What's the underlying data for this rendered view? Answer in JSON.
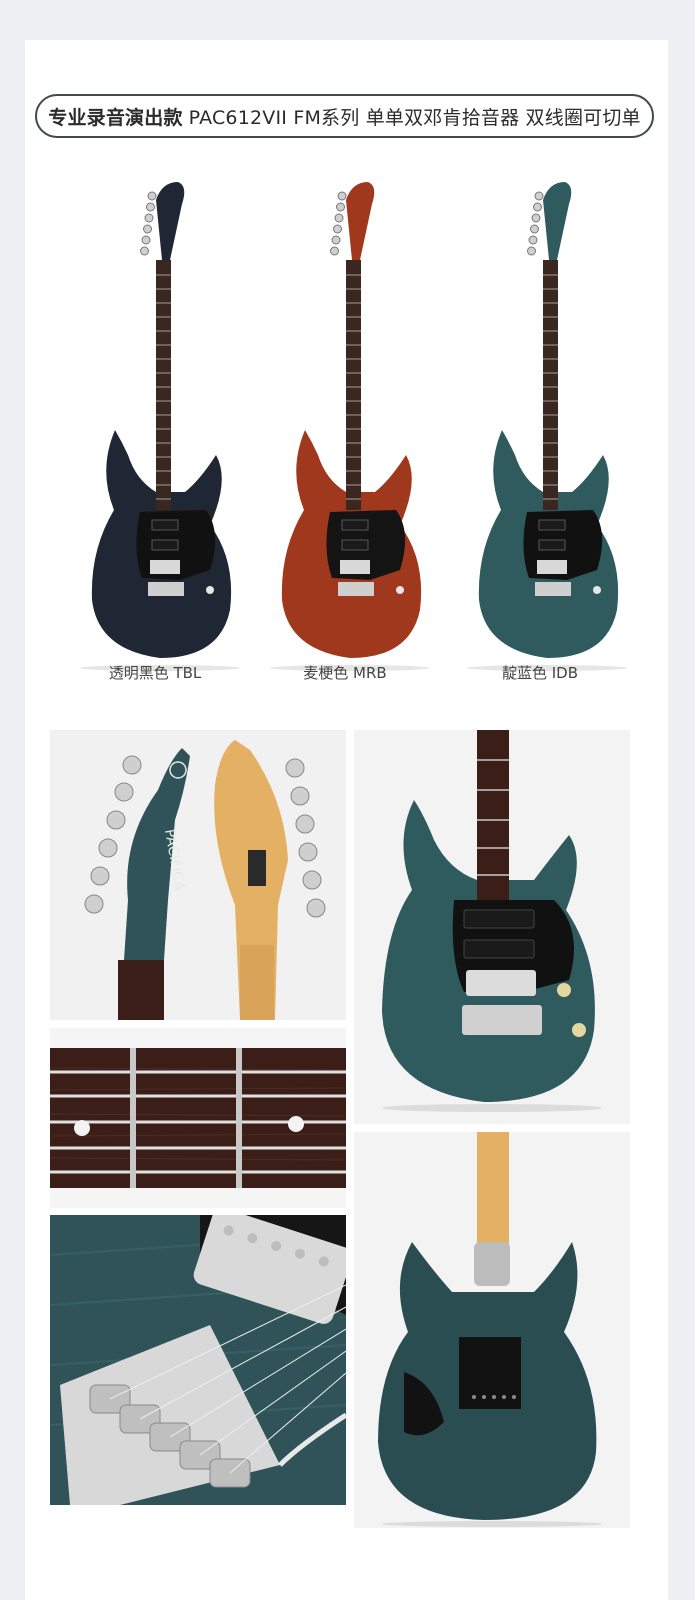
{
  "header": {
    "title_bold": "专业录音演出款",
    "title_rest": "PAC612VII FM系列 单单双邓肯拾音器 双线圈可切单"
  },
  "variants": [
    {
      "label": "透明黑色 TBL",
      "body_color": "#1e2733",
      "head_color": "#1e2733",
      "neck_color": "#3a2820",
      "pickguard": "#111111"
    },
    {
      "label": "麦梗色 MRB",
      "body_color": "#a0381d",
      "head_color": "#a0381d",
      "neck_color": "#3a2820",
      "pickguard": "#141414"
    },
    {
      "label": "靛蓝色 IDB",
      "body_color": "#2f5a5e",
      "head_color": "#2f5a5e",
      "neck_color": "#3a2820",
      "pickguard": "#111111"
    }
  ],
  "headstock_logo": "PACIFICA",
  "colors": {
    "page_bg": "#eef0f3",
    "card_bg": "#ffffff",
    "pill_border": "#3f4a52",
    "teal_body": "#2f5a5e",
    "maple_neck": "#e3b064",
    "rosewood": "#3b1e18",
    "chrome": "#d9d9d9"
  }
}
